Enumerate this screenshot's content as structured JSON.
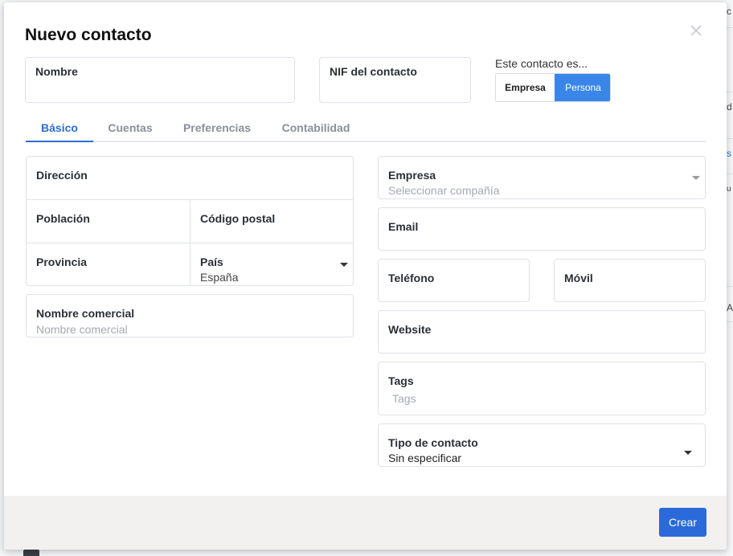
{
  "modal": {
    "title": "Nuevo contacto"
  },
  "top_fields": {
    "nombre_label": "Nombre",
    "nif_label": "NIF del contacto"
  },
  "contact_type": {
    "label": "Este contacto es...",
    "options": [
      "Empresa",
      "Persona"
    ],
    "selected": "Persona"
  },
  "tabs": [
    {
      "label": "Básico",
      "active": true
    },
    {
      "label": "Cuentas",
      "active": false
    },
    {
      "label": "Preferencias",
      "active": false
    },
    {
      "label": "Contabilidad",
      "active": false
    }
  ],
  "address": {
    "direccion_label": "Dirección",
    "poblacion_label": "Población",
    "codigo_postal_label": "Código postal",
    "provincia_label": "Provincia",
    "pais_label": "País",
    "pais_value": "España"
  },
  "nombre_comercial": {
    "label": "Nombre comercial",
    "placeholder": "Nombre comercial"
  },
  "right_fields": {
    "empresa_label": "Empresa",
    "empresa_placeholder": "Seleccionar compañía",
    "email_label": "Email",
    "telefono_label": "Teléfono",
    "movil_label": "Móvil",
    "website_label": "Website",
    "tags_label": "Tags",
    "tags_placeholder": "Tags",
    "tipo_label": "Tipo de contacto",
    "tipo_value": "Sin especificar"
  },
  "footer": {
    "create_label": "Crear"
  },
  "colors": {
    "accent": "#2a6bd9",
    "toggle_selected": "#3a86e8",
    "footer_bg": "#f2f1f0"
  }
}
